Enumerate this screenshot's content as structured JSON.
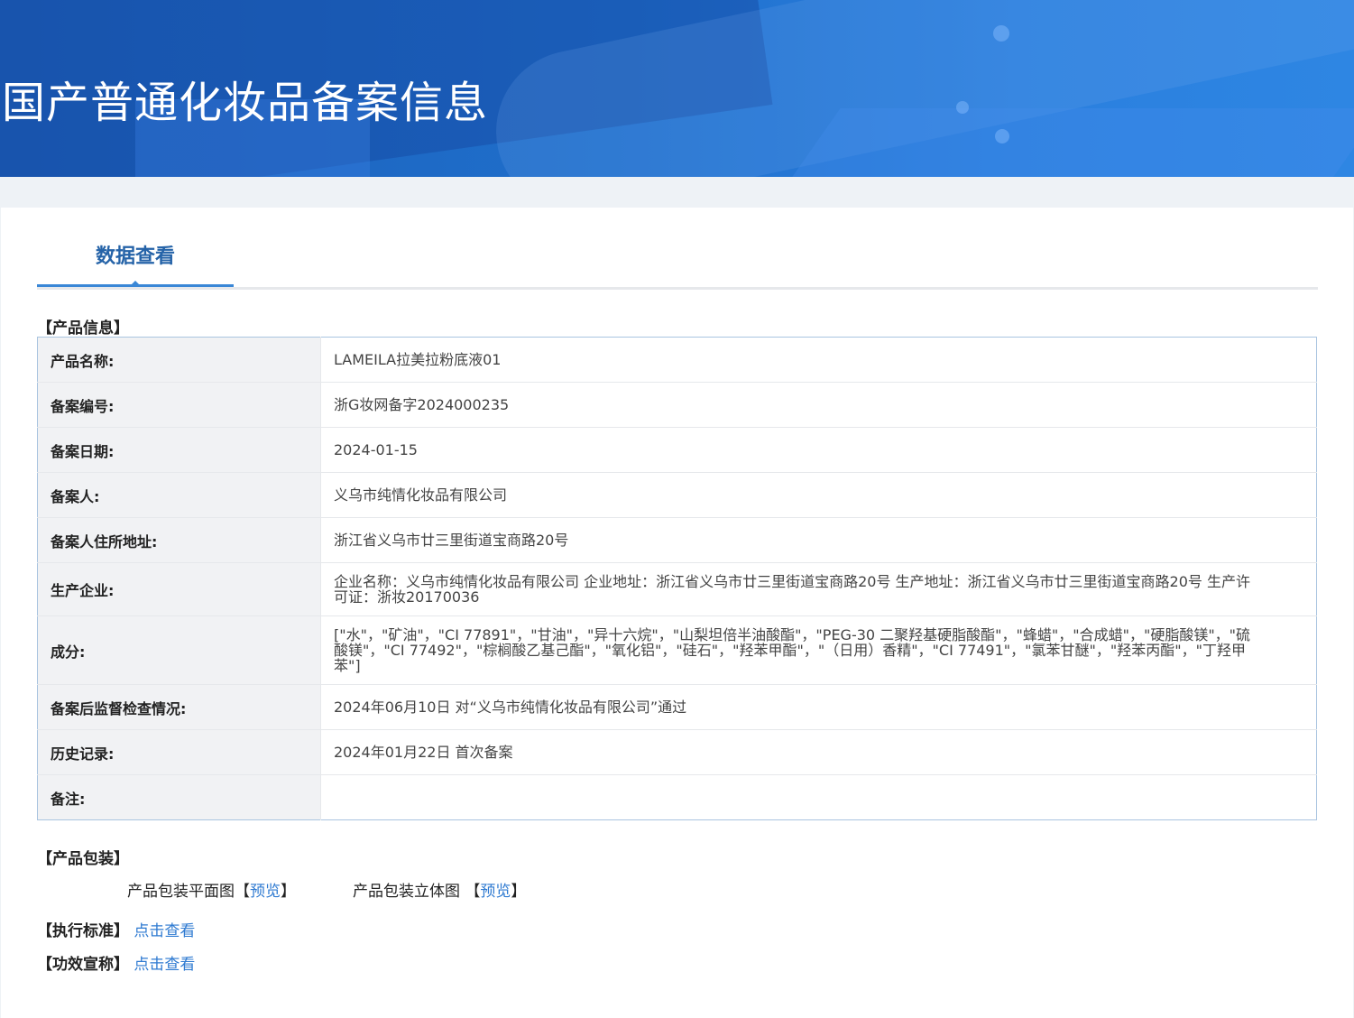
{
  "header": {
    "title": "国产普通化妆品备案信息"
  },
  "tabs": [
    {
      "label": "数据查看",
      "active": true
    }
  ],
  "product_info": {
    "section_title": "【产品信息】",
    "rows": [
      {
        "label": "产品名称:",
        "value": "LAMEILA拉美拉粉底液01"
      },
      {
        "label": "备案编号:",
        "value": "浙G妆网备字2024000235"
      },
      {
        "label": "备案日期:",
        "value": "2024-01-15"
      },
      {
        "label": "备案人:",
        "value": "义乌市纯情化妆品有限公司"
      },
      {
        "label": "备案人住所地址:",
        "value": "浙江省义乌市廿三里街道宝商路20号"
      },
      {
        "label": "生产企业:",
        "value": "企业名称：义乌市纯情化妆品有限公司 企业地址：浙江省义乌市廿三里街道宝商路20号 生产地址：浙江省义乌市廿三里街道宝商路20号 生产许可证：浙妆20170036"
      },
      {
        "label": "成分:",
        "value": "[\"水\"，\"矿油\"，\"CI 77891\"，\"甘油\"，\"异十六烷\"，\"山梨坦倍半油酸酯\"，\"PEG-30 二聚羟基硬脂酸酯\"，\"蜂蜡\"，\"合成蜡\"，\"硬脂酸镁\"，\"硫酸镁\"，\"CI 77492\"，\"棕榈酸乙基己酯\"，\"氧化铝\"，\"硅石\"，\"羟苯甲酯\"，\"（日用）香精\"，\"CI 77491\"，\"氯苯甘醚\"，\"羟苯丙酯\"，\"丁羟甲苯\"]"
      },
      {
        "label": "备案后监督检查情况:",
        "value": "2024年06月10日 对“义乌市纯情化妆品有限公司”通过"
      },
      {
        "label": "历史记录:",
        "value": "2024年01月22日 首次备案"
      },
      {
        "label": "备注:",
        "value": ""
      }
    ]
  },
  "packaging": {
    "section_title": "【产品包装】",
    "flat_label": "产品包装平面图",
    "flat_open": "【",
    "flat_link": "预览",
    "flat_close": "】",
    "solid_label": "产品包装立体图",
    "solid_open": "【",
    "solid_link": "预览",
    "solid_close": "】"
  },
  "standard": {
    "label": "【执行标准】",
    "link": "点击查看"
  },
  "efficacy": {
    "label": "【功效宣称】",
    "link": "点击查看"
  }
}
